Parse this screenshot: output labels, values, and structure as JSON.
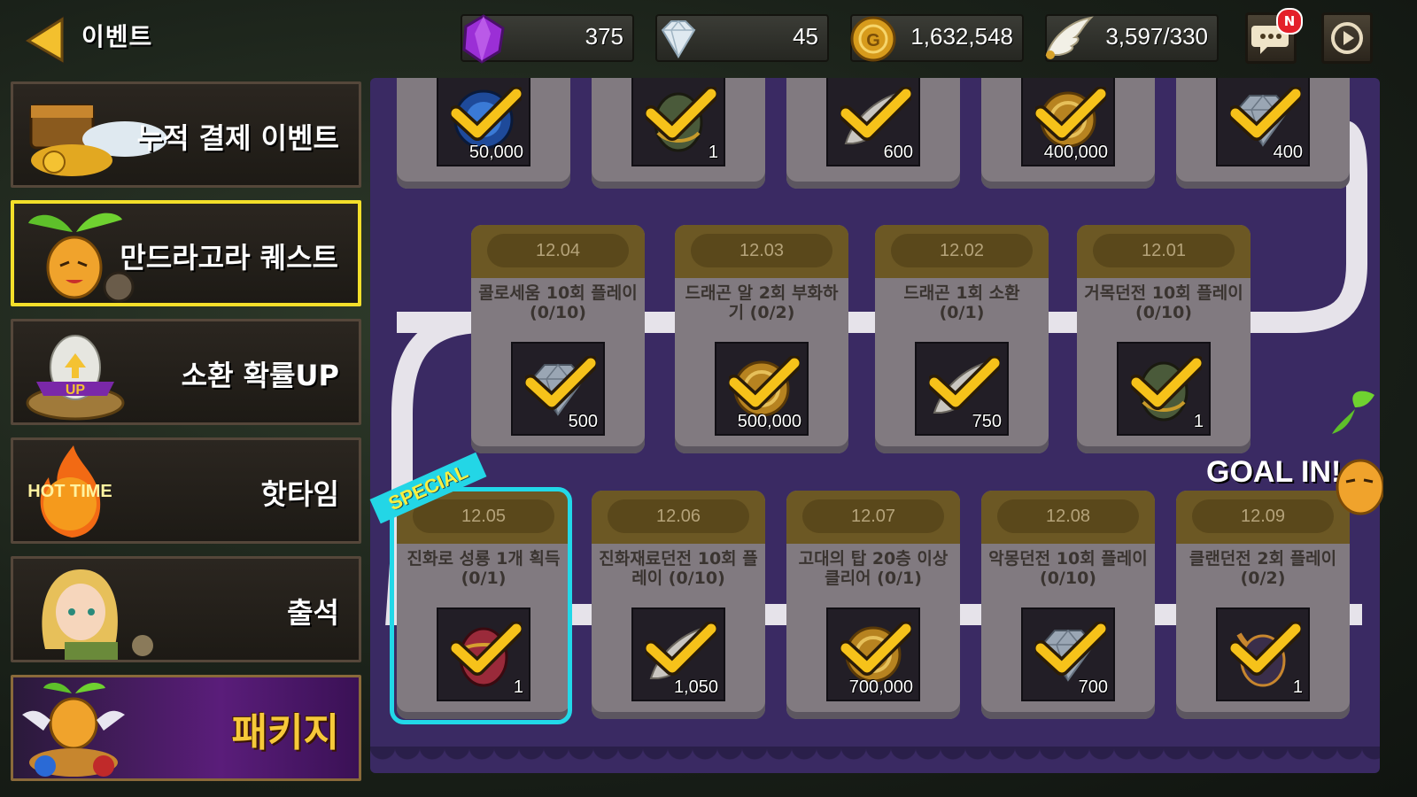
{
  "header": {
    "title": "이벤트"
  },
  "resources": [
    {
      "icon": "purple-gem-icon",
      "value": "375"
    },
    {
      "icon": "diamond-icon",
      "value": "45"
    },
    {
      "icon": "gold-coin-icon",
      "value": "1,632,548"
    },
    {
      "icon": "wing-icon",
      "value": "3,597/330"
    }
  ],
  "top_buttons": [
    {
      "icon": "chat-icon",
      "badge": "N"
    },
    {
      "icon": "quest-icon"
    }
  ],
  "sidebar": [
    {
      "label": "누적 결제 이벤트",
      "selected": false
    },
    {
      "label": "만드라고라 퀘스트",
      "selected": true
    },
    {
      "label": "소환 확률UP",
      "art_text": "UP",
      "selected": false
    },
    {
      "label": "핫타임",
      "art_text": "HOT TIME",
      "selected": false
    },
    {
      "label": "출석",
      "selected": false
    },
    {
      "label": "패키지",
      "selected": false
    }
  ],
  "top_rewards": [
    {
      "item": "blue-orb",
      "qty": "50,000"
    },
    {
      "item": "egg",
      "qty": "1"
    },
    {
      "item": "feather",
      "qty": "600"
    },
    {
      "item": "gold-coin",
      "qty": "400,000"
    },
    {
      "item": "diamond",
      "qty": "400"
    }
  ],
  "middle_quests": [
    {
      "date": "12.04",
      "desc": "콜로세움 10회 플레이 (0/10)",
      "item": "diamond",
      "qty": "500"
    },
    {
      "date": "12.03",
      "desc": "드래곤 알 2회 부화하기 (0/2)",
      "item": "gold-coin",
      "qty": "500,000"
    },
    {
      "date": "12.02",
      "desc": "드래곤 1회 소환 (0/1)",
      "item": "feather",
      "qty": "750"
    },
    {
      "date": "12.01",
      "desc": "거목던전 10회 플레이 (0/10)",
      "item": "egg",
      "qty": "1"
    }
  ],
  "bottom_quests": [
    {
      "date": "12.05",
      "desc": "진화로 성룡 1개 획득 (0/1)",
      "item": "red-egg",
      "qty": "1",
      "special": true
    },
    {
      "date": "12.06",
      "desc": "진화재료던전 10회 플레이 (0/10)",
      "item": "feather",
      "qty": "1,050"
    },
    {
      "date": "12.07",
      "desc": "고대의 탑 20층 이상 클리어 (0/1)",
      "item": "gold-coin",
      "qty": "700,000"
    },
    {
      "date": "12.08",
      "desc": "악몽던전 10회 플레이 (0/10)",
      "item": "diamond",
      "qty": "700"
    },
    {
      "date": "12.09",
      "desc": "클랜던전 2회 플레이 (0/2)",
      "item": "horned-egg",
      "qty": "1"
    }
  ],
  "special_label": "SPECIAL",
  "goal_label": "GOAL IN!",
  "colors": {
    "board": "#3a2a63",
    "path": "#e6e3ea",
    "card": "#817a80",
    "header": "#6c5824",
    "check": "#f6c21a",
    "special": "#22d8e8",
    "selected": "#f3df2a"
  }
}
